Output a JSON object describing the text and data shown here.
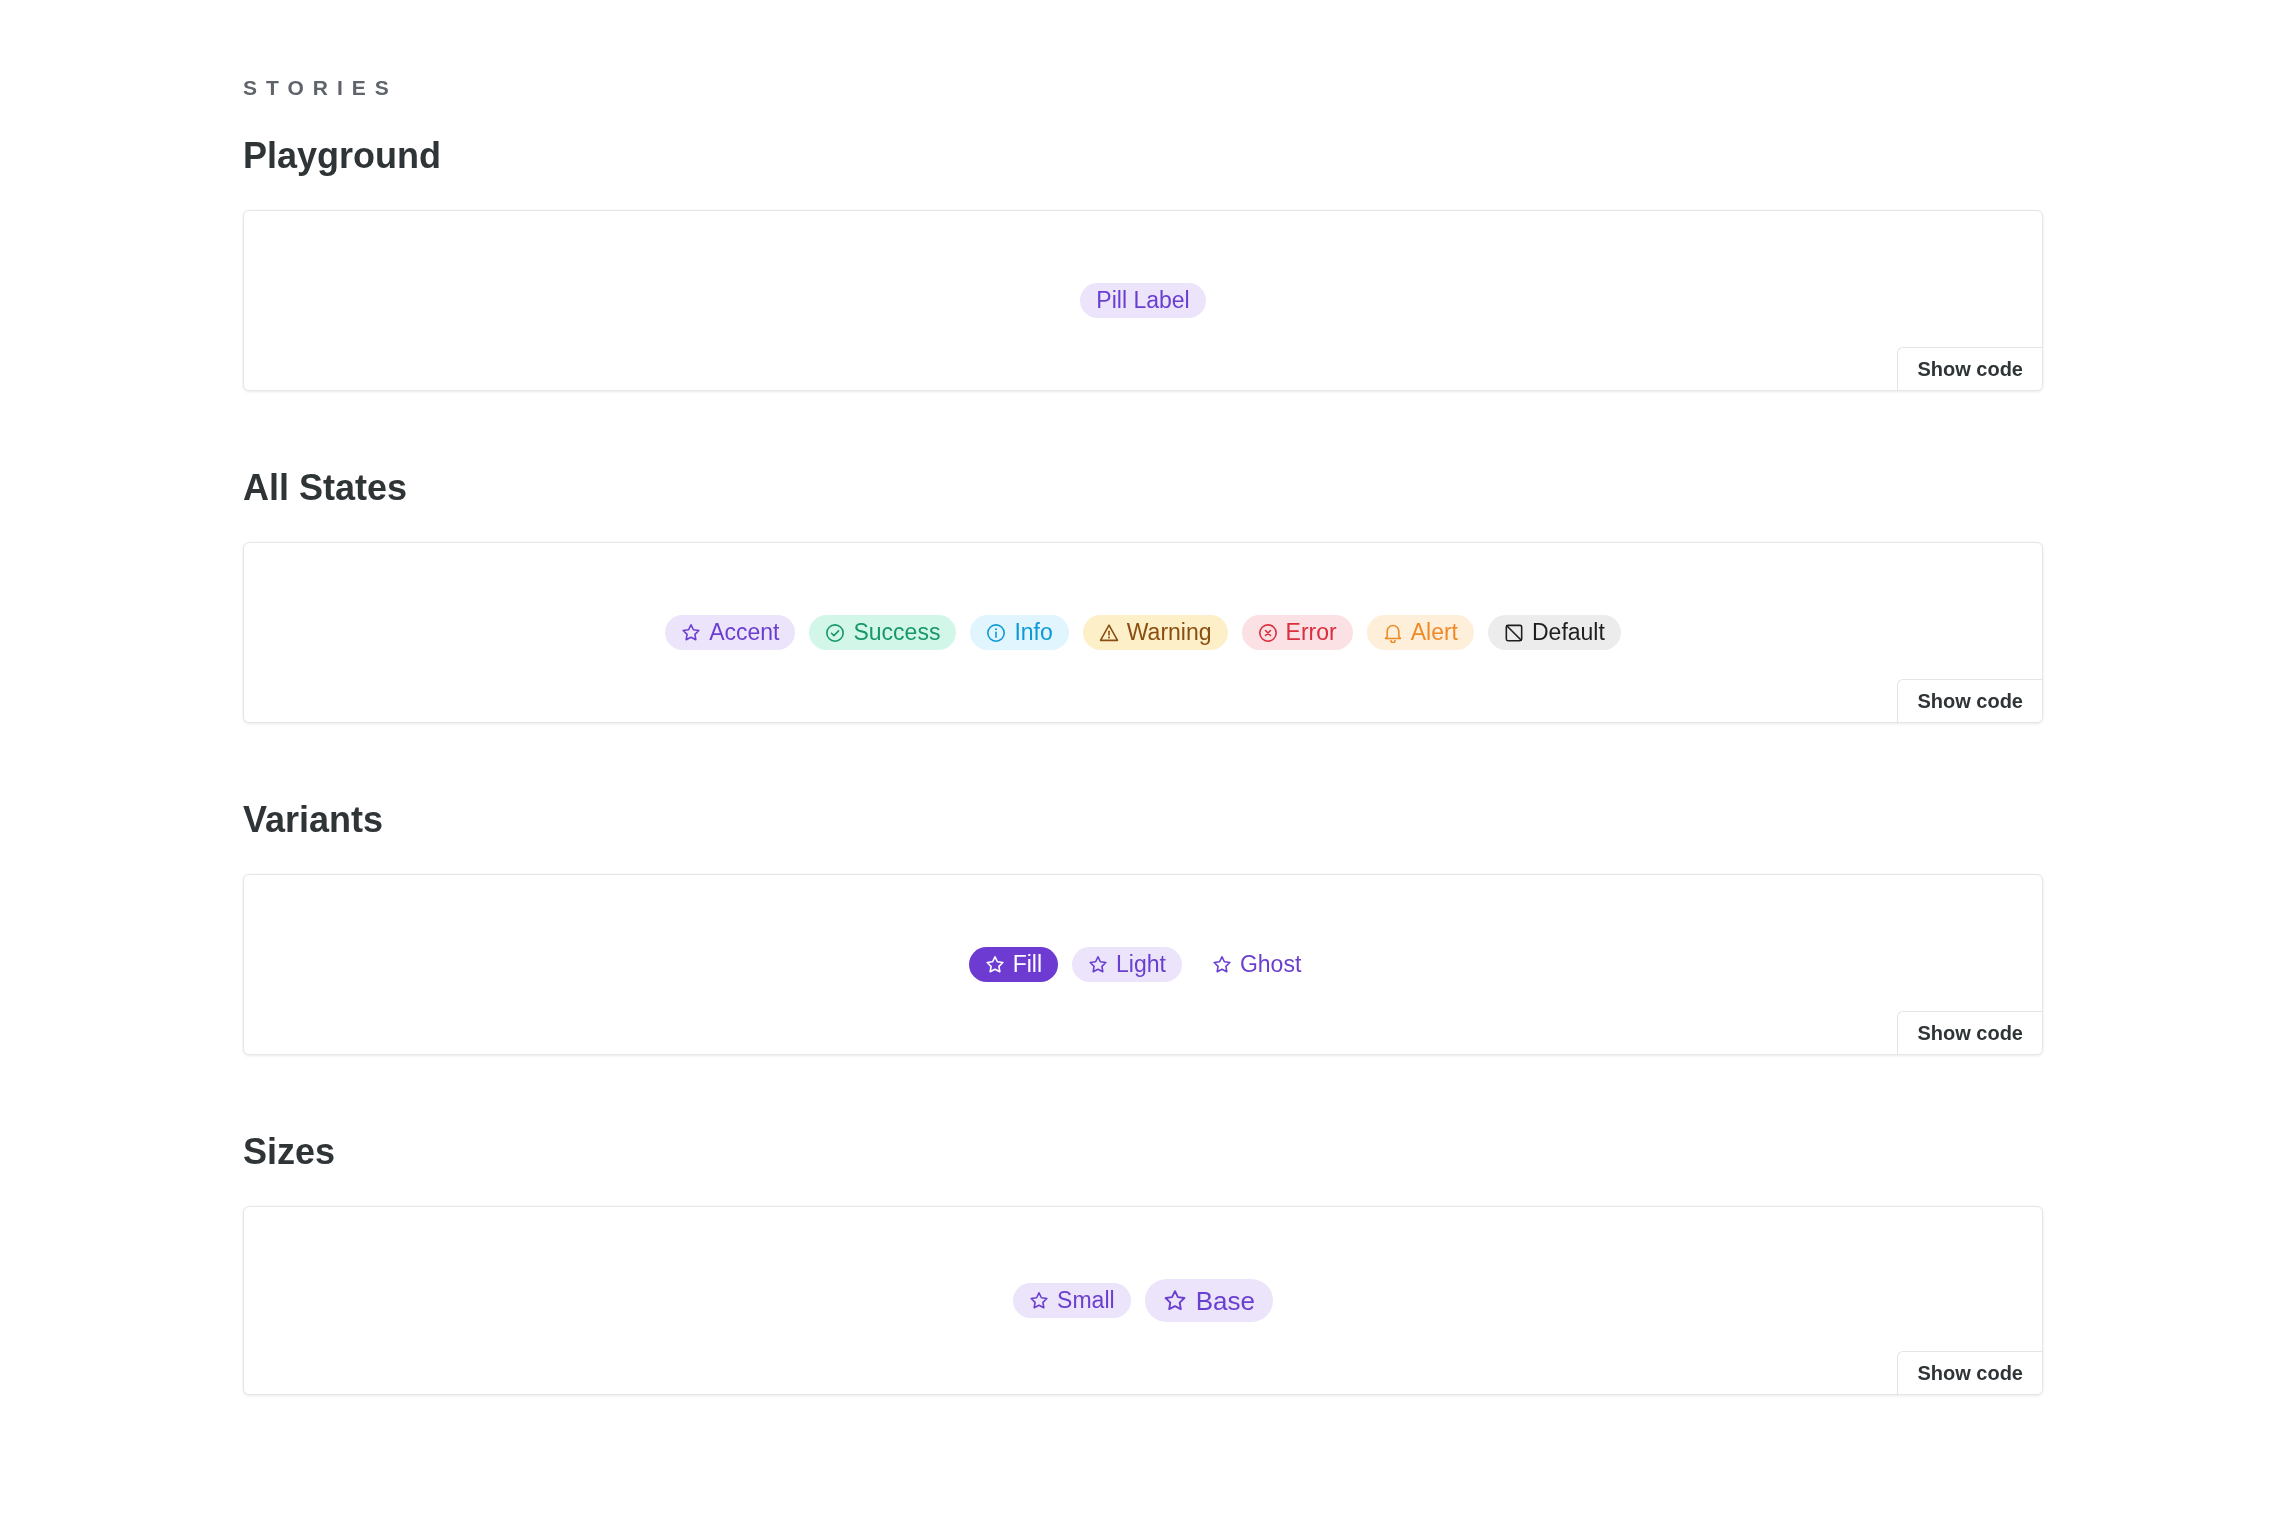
{
  "eyebrow": "STORIES",
  "sections": [
    {
      "title": "Playground",
      "pills": [
        {
          "label": "Pill Label",
          "kind": "plain"
        }
      ],
      "button": "Show code"
    },
    {
      "title": "All States",
      "pills": [
        {
          "label": "Accent",
          "kind": "accent"
        },
        {
          "label": "Success",
          "kind": "success"
        },
        {
          "label": "Info",
          "kind": "info"
        },
        {
          "label": "Warning",
          "kind": "warning"
        },
        {
          "label": "Error",
          "kind": "error"
        },
        {
          "label": "Alert",
          "kind": "alert"
        },
        {
          "label": "Default",
          "kind": "default"
        }
      ],
      "button": "Show code"
    },
    {
      "title": "Variants",
      "pills": [
        {
          "label": "Fill",
          "kind": "fill"
        },
        {
          "label": "Light",
          "kind": "accent"
        },
        {
          "label": "Ghost",
          "kind": "ghost"
        }
      ],
      "button": "Show code"
    },
    {
      "title": "Sizes",
      "pills": [
        {
          "label": "Small",
          "kind": "accent"
        },
        {
          "label": "Base",
          "kind": "large"
        }
      ],
      "button": "Show code"
    }
  ]
}
